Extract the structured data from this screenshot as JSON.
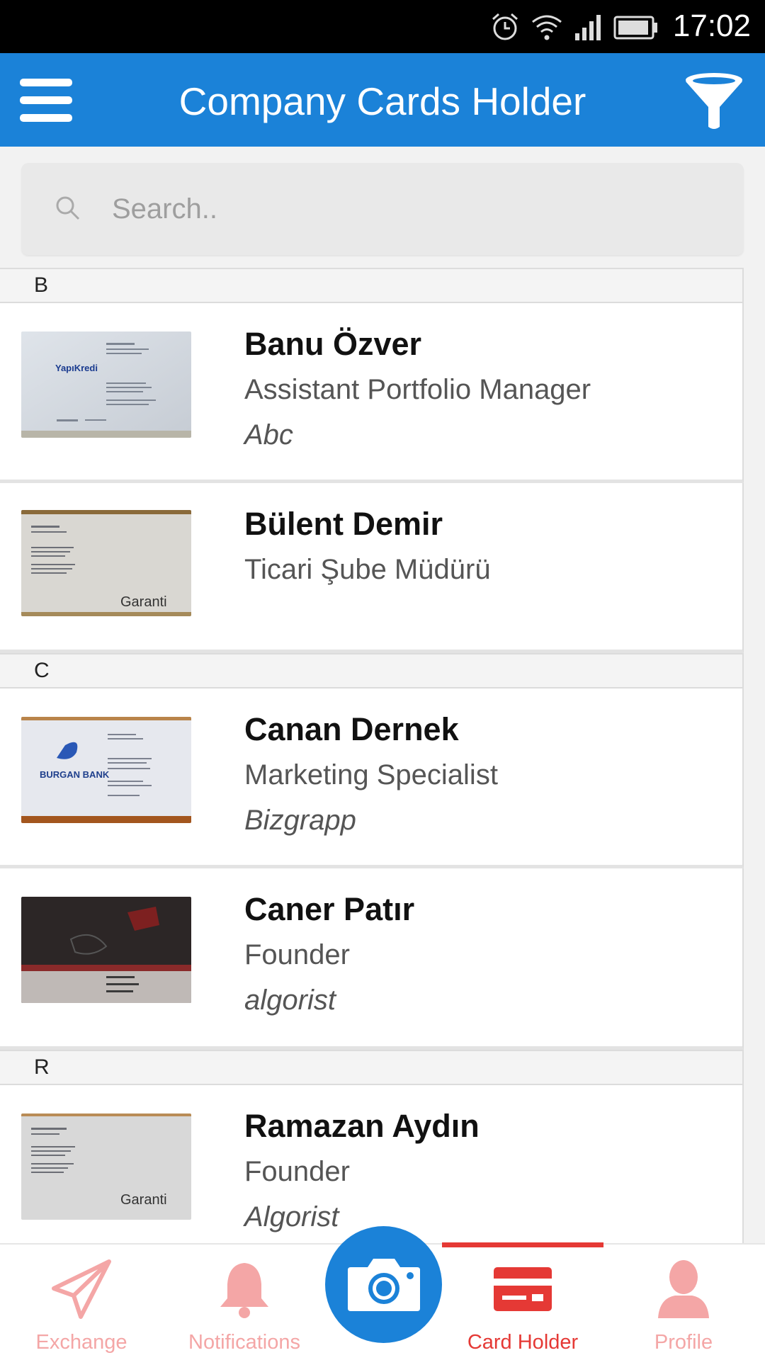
{
  "status_bar": {
    "time": "17:02"
  },
  "app_bar": {
    "title": "Company Cards Holder"
  },
  "search": {
    "placeholder": "Search.."
  },
  "sections": [
    {
      "letter": "B",
      "cards": [
        {
          "name": "Banu Özver",
          "title": "Assistant Portfolio Manager",
          "company": "Abc",
          "card_logo": "YapıKredi"
        },
        {
          "name": "Bülent Demir",
          "title": "Ticari Şube Müdürü",
          "company": "",
          "card_logo": "Garanti"
        }
      ]
    },
    {
      "letter": "C",
      "cards": [
        {
          "name": "Canan Dernek",
          "title": "Marketing Specialist",
          "company": "Bizgrapp",
          "card_logo": "BURGAN BANK"
        },
        {
          "name": "Caner Patır",
          "title": "Founder",
          "company": "algorist",
          "card_logo": ""
        }
      ]
    },
    {
      "letter": "R",
      "cards": [
        {
          "name": "Ramazan Aydın",
          "title": "Founder",
          "company": "Algorist",
          "card_logo": "Garanti"
        }
      ]
    }
  ],
  "bottom_nav": {
    "exchange": "Exchange",
    "notifications": "Notifications",
    "card_holder": "Card Holder",
    "profile": "Profile"
  },
  "colors": {
    "primary": "#1b82d8",
    "accent": "#e53935",
    "accent_faded": "#f4a6a6"
  }
}
